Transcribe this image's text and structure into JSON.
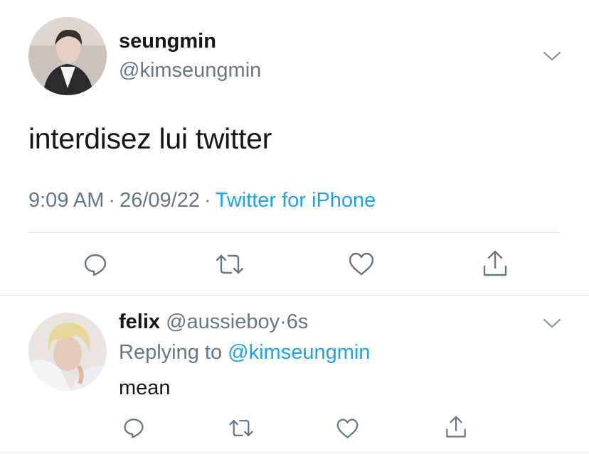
{
  "main_tweet": {
    "author_name": "seungmin",
    "author_handle": "@kimseungmin",
    "text": "interdisez lui twitter",
    "time": "9:09 AM",
    "date": "26/09/22",
    "source": "Twitter for iPhone",
    "separator": "·"
  },
  "reply": {
    "author_name": "felix",
    "author_handle": "@aussieboy",
    "separator": "·",
    "time": "6s",
    "replying_label": "Replying to",
    "replying_to": "@kimseungmin",
    "text": "mean"
  },
  "icons": {
    "menu": "chevron-down-icon",
    "reply": "reply-icon",
    "retweet": "retweet-icon",
    "like": "heart-icon",
    "share": "share-icon"
  },
  "colors": {
    "text": "#14171a",
    "secondary": "#657786",
    "link": "#1da1f2",
    "icon": "#657786",
    "divider": "#dfe3e6"
  }
}
